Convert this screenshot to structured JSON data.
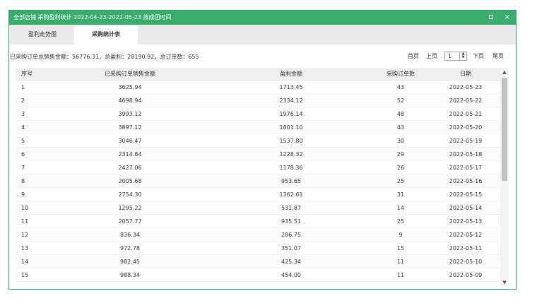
{
  "window": {
    "title": "全部店铺 采购盈利统计 2022-04-23-2022-05-23 按成团时间",
    "maximize_icon": "maximize-icon",
    "close_icon": "close-icon",
    "close_label": "×"
  },
  "tabs": [
    {
      "label": "盈利走势图",
      "active": false
    },
    {
      "label": "采购统计表",
      "active": true
    }
  ],
  "summary": "已采购订单总销售金额：56776.31，总盈利：28190.92，总订单数：655",
  "pager": {
    "first": "首页",
    "prev": "上页",
    "page": "1",
    "next": "下页",
    "last": "尾页"
  },
  "table": {
    "columns": [
      "序号",
      "已采购订单销售金额",
      "盈利金额",
      "采购订单数",
      "日期"
    ],
    "rows": [
      [
        "1",
        "3625.94",
        "1713.45",
        "43",
        "2022-05-23"
      ],
      [
        "2",
        "4698.94",
        "2334.12",
        "52",
        "2022-05-22"
      ],
      [
        "3",
        "3993.12",
        "1976.14",
        "48",
        "2022-05-21"
      ],
      [
        "4",
        "3897.12",
        "1801.10",
        "43",
        "2022-05-20"
      ],
      [
        "5",
        "3046.47",
        "1537.80",
        "30",
        "2022-05-19"
      ],
      [
        "6",
        "2314.84",
        "1228.32",
        "29",
        "2022-05-18"
      ],
      [
        "7",
        "2427.06",
        "1178.36",
        "26",
        "2022-05-17"
      ],
      [
        "8",
        "2005.68",
        "953.65",
        "25",
        "2022-05-16"
      ],
      [
        "9",
        "2754.30",
        "1362.61",
        "31",
        "2022-05-15"
      ],
      [
        "10",
        "1295.22",
        "531.87",
        "14",
        "2022-05-14"
      ],
      [
        "11",
        "2057.77",
        "935.51",
        "25",
        "2022-05-13"
      ],
      [
        "12",
        "836.34",
        "286.75",
        "9",
        "2022-05-12"
      ],
      [
        "13",
        "972.78",
        "351.07",
        "15",
        "2022-05-11"
      ],
      [
        "14",
        "982.45",
        "425.34",
        "11",
        "2022-05-10"
      ],
      [
        "15",
        "988.34",
        "454.00",
        "11",
        "2022-05-09"
      ]
    ]
  },
  "colors": {
    "accent": "#3aac6e",
    "border": "#2fa36b"
  }
}
